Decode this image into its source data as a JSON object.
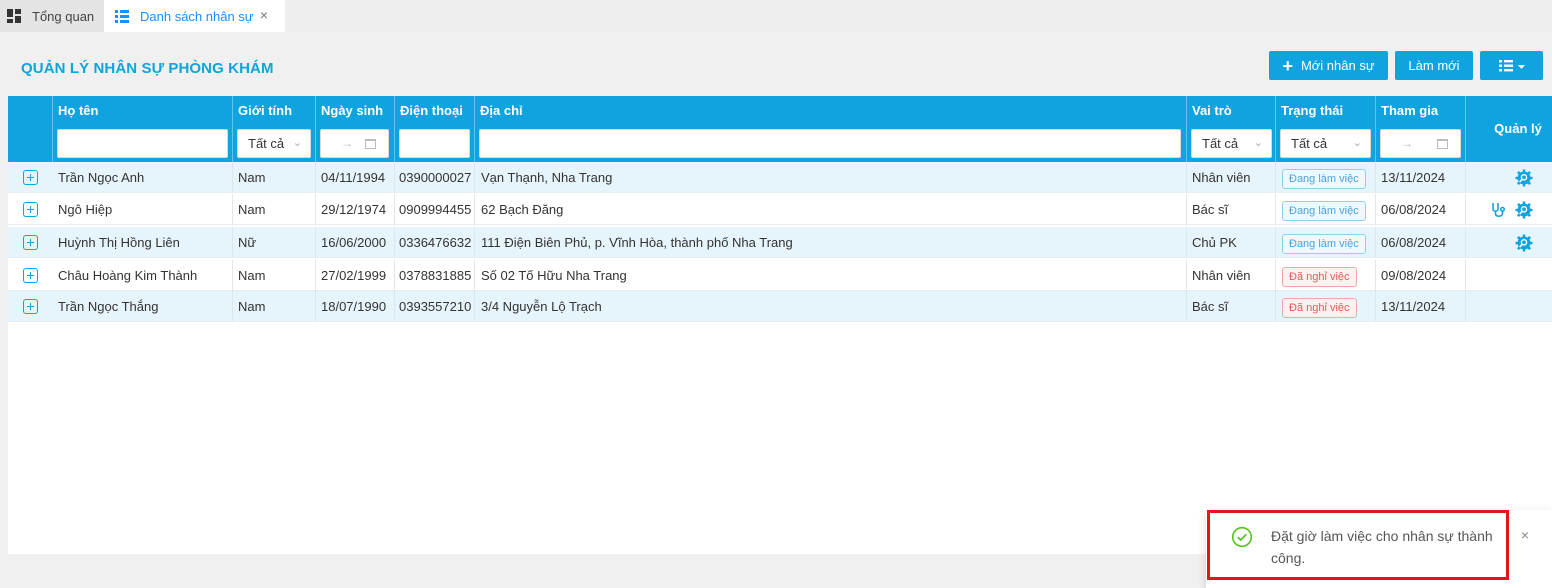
{
  "tabs": [
    {
      "label": "Tổng quan",
      "icon": "dashboard-icon"
    },
    {
      "label": "Danh sách nhân sự",
      "icon": "list-icon",
      "close": "×"
    }
  ],
  "page": {
    "title": "QUẢN LÝ NHÂN SỰ PHÒNG KHÁM",
    "new_label": "Mới nhân sự",
    "new_plus": "+",
    "refresh_label": "Làm mới"
  },
  "table": {
    "headers": {
      "name": "Họ tên",
      "gender": "Giới tính",
      "birth": "Ngày sinh",
      "phone": "Điện thoại",
      "address": "Địa chỉ",
      "role": "Vai trò",
      "status": "Trạng thái",
      "joined": "Tham gia",
      "manage": "Quản lý"
    },
    "filters": {
      "gender": "Tất cả",
      "role": "Tất cả",
      "status": "Tất cả",
      "date_arrow": "→"
    },
    "rows": [
      {
        "name": "Trần Ngọc Anh",
        "gender": "Nam",
        "birth": "04/11/1994",
        "phone": "0390000027",
        "address": "Vạn Thạnh, Nha Trang",
        "role": "Nhân viên",
        "status": "Đang làm việc",
        "joined": "13/11/2024"
      },
      {
        "name": "Ngô Hiệp",
        "gender": "Nam",
        "birth": "29/12/1974",
        "phone": "0909994455",
        "address": "62 Bạch Đăng",
        "role": "Bác sĩ",
        "status": "Đang làm việc",
        "joined": "06/08/2024"
      },
      {
        "name": "Huỳnh Thị Hồng Liên",
        "gender": "Nữ",
        "birth": "16/06/2000",
        "phone": "0336476632",
        "address": "111 Điện Biên Phủ, p. Vĩnh Hòa, thành phố Nha Trang",
        "role": "Chủ PK",
        "status": "Đang làm việc",
        "joined": "06/08/2024"
      },
      {
        "name": "Châu Hoàng Kim Thành",
        "gender": "Nam",
        "birth": "27/02/1999",
        "phone": "0378831885",
        "address": "Số 02 Tố Hữu Nha Trang",
        "role": "Nhân viên",
        "status": "Đã nghỉ việc",
        "joined": "09/08/2024"
      },
      {
        "name": "Trần Ngọc Thắng",
        "gender": "Nam",
        "birth": "18/07/1990",
        "phone": "0393557210",
        "address": "3/4 Nguyễn Lộ Trạch",
        "role": "Bác sĩ",
        "status": "Đã nghỉ việc",
        "joined": "13/11/2024"
      }
    ]
  },
  "toast": {
    "message": "Đặt giờ làm việc cho nhân sự thành công.",
    "close": "×"
  },
  "colors": {
    "accent": "#0fa3e0",
    "title": "#0ea5d9",
    "success": "#52c41a",
    "danger": "#e05a5a"
  }
}
